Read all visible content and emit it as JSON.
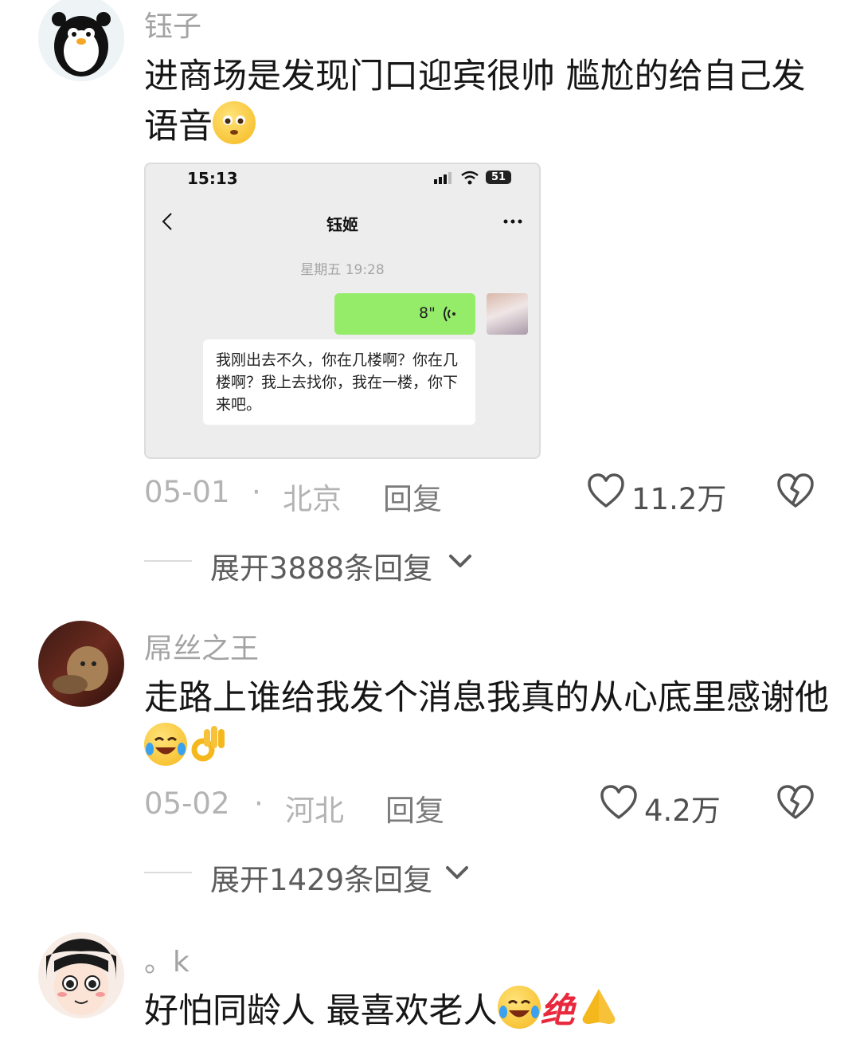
{
  "comments": [
    {
      "username": "钰子",
      "text": "进商场是发现门口迎宾很帅 尴尬的给自己发语音",
      "date": "05-01",
      "location": "北京",
      "reply_label": "回复",
      "likes": "11.2万",
      "expand_label": "展开3888条回复"
    },
    {
      "username": "屌丝之王",
      "text": "走路上谁给我发个消息我真的从心底里感谢他",
      "date": "05-02",
      "location": "河北",
      "reply_label": "回复",
      "likes": "4.2万",
      "expand_label": "展开1429条回复"
    },
    {
      "username": "。k",
      "text": "好怕同龄人 最喜欢老人",
      "inline_text": "绝"
    }
  ],
  "dot_separator": "·",
  "screenshot": {
    "status_time": "15:13",
    "battery": "51",
    "chat_title": "钰姬",
    "date_label": "星期五 19:28",
    "voice_duration": "8\"",
    "message": "我刚出去不久，你在几楼啊？你在几楼啊？我上去找你，我在一楼，你下来吧。"
  },
  "icons": [
    "heart-outline-icon",
    "broken-heart-icon",
    "chevron-down-icon",
    "back-chevron-icon",
    "more-dots-icon",
    "wifi-icon",
    "signal-icon",
    "battery-icon",
    "voice-wave-icon"
  ],
  "colors": {
    "voice_bubble": "#95ec69",
    "username": "#a3a3a3"
  }
}
